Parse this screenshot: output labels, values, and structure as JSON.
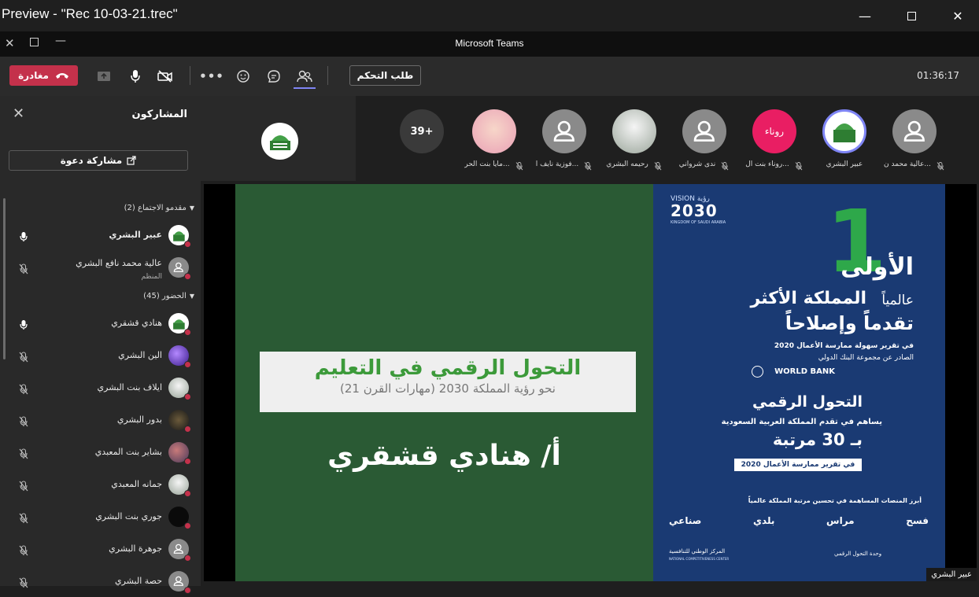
{
  "window": {
    "title": "Preview - \"Rec 10-03-21.trec\""
  },
  "app": {
    "name": "Microsoft Teams"
  },
  "toolbar": {
    "leave_label": "مغادرة",
    "request_control_label": "طلب التحكم",
    "timer": "01:36:17",
    "icons": [
      "share-tray-icon",
      "mic-icon",
      "camera-off-icon",
      "more-icon",
      "reactions-icon",
      "chat-icon",
      "participants-icon"
    ]
  },
  "panel": {
    "title": "المشاركون",
    "invite_label": "مشاركة دعوة",
    "presenters_header": "مقدمو الاجتماع (2)",
    "attendees_header": "الحضور (45)",
    "presenters": [
      {
        "name": "عبير البشري",
        "sub": "",
        "mic": "on",
        "avatar": "logo"
      },
      {
        "name": "عالية محمد نافع البشري",
        "sub": "المنظم",
        "mic": "off",
        "avatar": "person"
      }
    ],
    "attendees": [
      {
        "name": "هنادي قشقري",
        "mic": "on",
        "avatar": "logo"
      },
      {
        "name": "الين البشري",
        "mic": "off",
        "avatar": "purple"
      },
      {
        "name": "ايلاف بنت البشري",
        "mic": "off",
        "avatar": "photo-light"
      },
      {
        "name": "بدور البشري",
        "mic": "off",
        "avatar": "photo-dark"
      },
      {
        "name": "بشاير بنت المعبدي",
        "mic": "off",
        "avatar": "photo-mixed"
      },
      {
        "name": "جمانه المعبدي",
        "mic": "off",
        "avatar": "photo-light"
      },
      {
        "name": "جوري بنت البشري",
        "mic": "off",
        "avatar": "photo-black"
      },
      {
        "name": "جوهرة البشري",
        "mic": "off",
        "avatar": "person"
      },
      {
        "name": "حصة البشري",
        "mic": "off",
        "avatar": "person"
      }
    ]
  },
  "strip": {
    "overflow_label": "39+",
    "participants": [
      {
        "name": "عالية محمد ن...",
        "avatar": "person",
        "muted": true
      },
      {
        "name": "عبير البشري",
        "avatar": "logo-ring",
        "muted": false
      },
      {
        "name": "روناء بنت ال...",
        "avatar": "pink",
        "initials": "روناء",
        "muted": true
      },
      {
        "name": "ندى شرواني",
        "avatar": "person",
        "muted": true
      },
      {
        "name": "رحيمه البشري",
        "avatar": "photo-light",
        "muted": true
      },
      {
        "name": "فوزية نايف ا...",
        "avatar": "person",
        "muted": true
      },
      {
        "name": "مايا بنت الحر...",
        "avatar": "photo-girl",
        "muted": true
      }
    ]
  },
  "slide": {
    "title_line1": "التحول الرقمي في التعليم",
    "title_line2": "(مهارات القرن 21) نحو رؤية المملكة 2030",
    "presenter_line": "أ/ هنادي قشقري",
    "right": {
      "vision_label": "VISION رؤية",
      "vision_year": "2030",
      "kingdom": "KINGDOM OF SAUDI ARABIA",
      "big_number": "1",
      "first": "الأولى",
      "globally": "عالمياً",
      "kingdom_most": "المملكة الأكثر",
      "progress": "تقدماً وإصلاحاً",
      "report_line1": "في تقرير سهولة ممارسة الأعمال 2020",
      "report_line2": "الصادر عن مجموعة البنك الدولي",
      "world_bank": "WORLD BANK",
      "digital": "التحول الرقمي",
      "contributes": "يساهم في تقدم المملكة العربية السعودية",
      "rank": "بـ 30 مرتبة",
      "in_report": "في تقرير ممارسة الأعمال 2020",
      "platforms": "أبرز المنصات المساهمة في تحسين مرتبة المملكة عالمياً",
      "logos": [
        "صناعي",
        "بلدي",
        "مراس",
        "فسح"
      ],
      "footer_left": "المركز الوطني للتنافسية",
      "footer_left_en": "NATIONAL COMPETITIVENESS CENTER",
      "footer_right": "وحدة التحول الرقمي"
    },
    "presenter_tag": "عبير البشري"
  },
  "colors": {
    "accent": "#6264a7",
    "danger": "#c4314b",
    "slide_green": "#2a5a34",
    "slide_blue": "#1a3a73"
  }
}
